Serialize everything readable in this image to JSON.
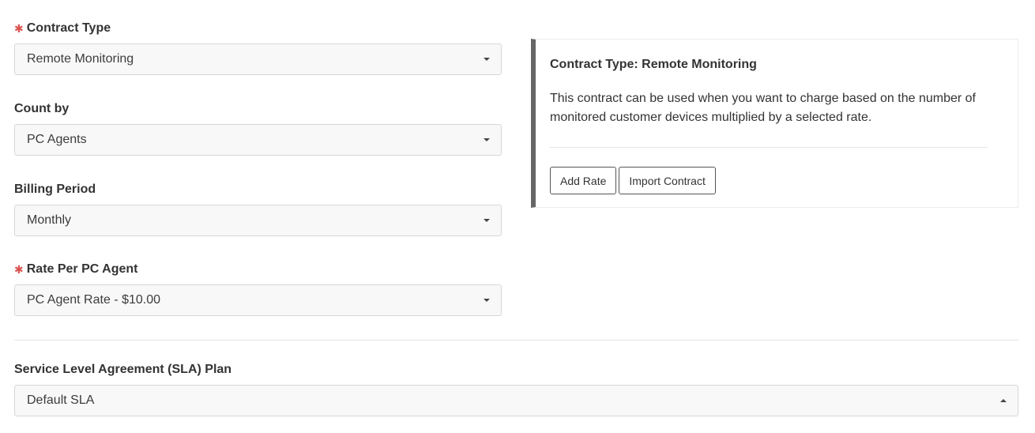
{
  "form": {
    "contract_type": {
      "label": "Contract Type",
      "required_mark": "✱",
      "value": "Remote Monitoring"
    },
    "count_by": {
      "label": "Count by",
      "value": "PC Agents"
    },
    "billing_period": {
      "label": "Billing Period",
      "value": "Monthly"
    },
    "rate": {
      "label": "Rate Per PC Agent",
      "required_mark": "✱",
      "value": "PC Agent Rate - $10.00"
    },
    "sla": {
      "label": "Service Level Agreement (SLA) Plan",
      "value": "Default SLA"
    }
  },
  "info_panel": {
    "title": "Contract Type: Remote Monitoring",
    "description": "This contract can be used when you want to charge based on the number of monitored customer devices multiplied by a selected rate.",
    "buttons": {
      "add_rate": "Add Rate",
      "import_contract": "Import Contract"
    }
  },
  "colors": {
    "required": "#d9534f",
    "panel_accent": "#666666",
    "select_bg": "#f8f8f8",
    "border": "#d7d7d7"
  },
  "icons": {
    "select_closed": "caret-down-icon",
    "select_open": "caret-up-icon",
    "required": "asterisk-icon"
  }
}
